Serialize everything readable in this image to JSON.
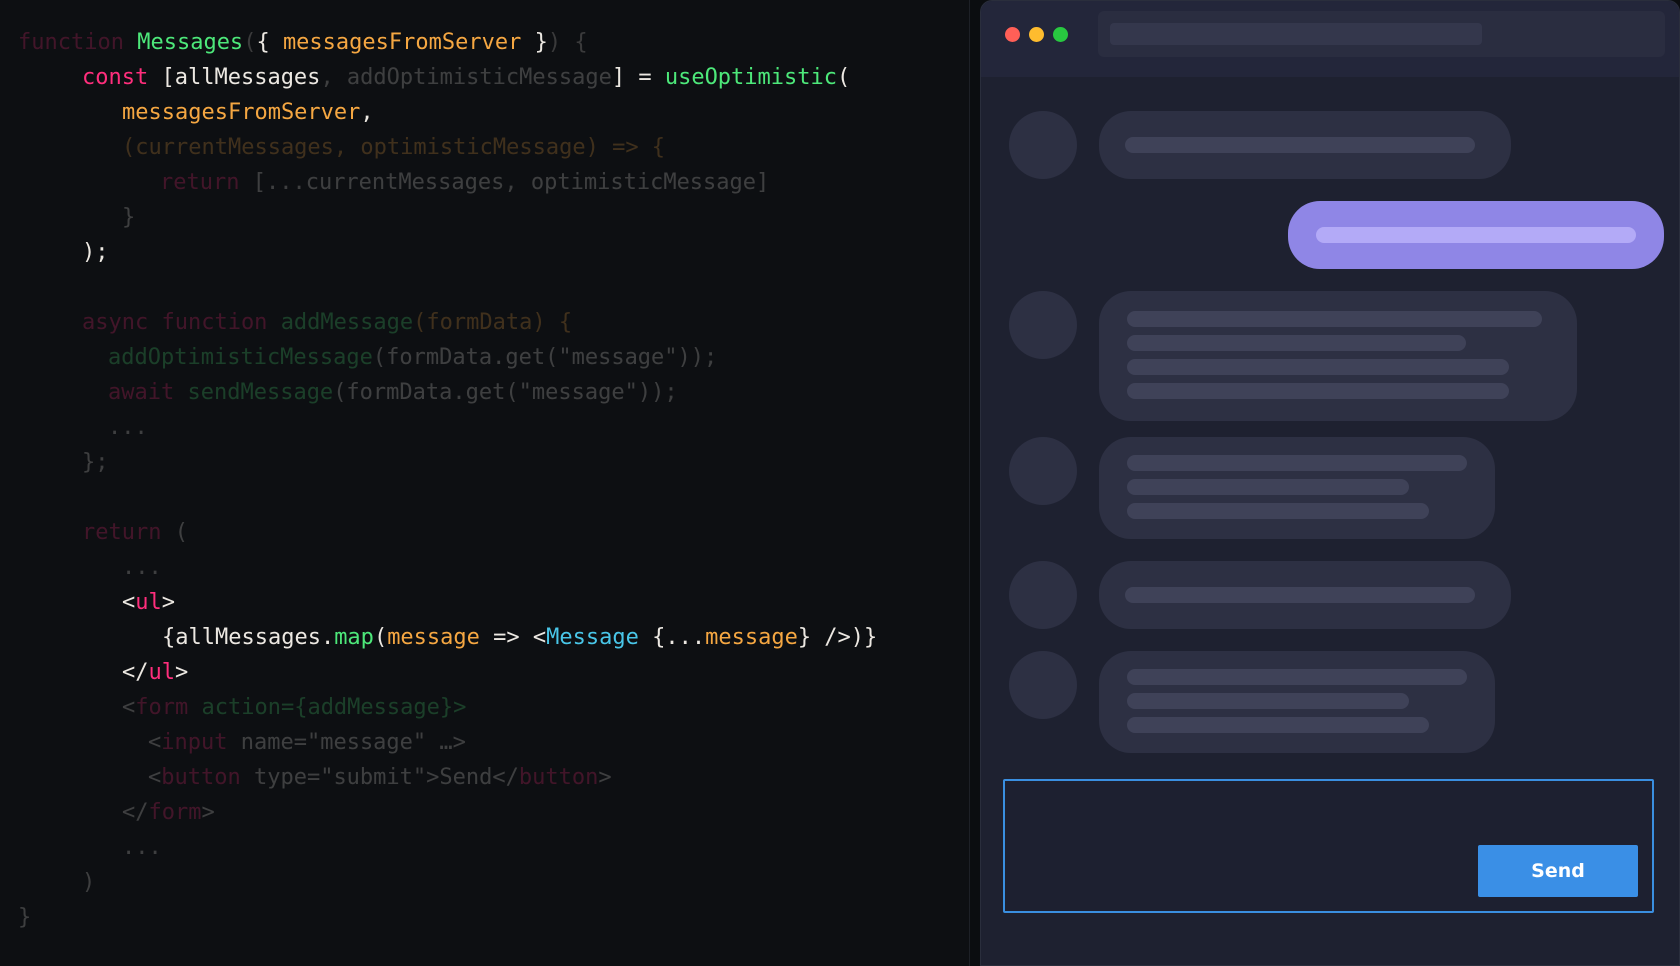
{
  "code_lines": [
    [
      {
        "t": "function ",
        "c": "kw",
        "d": true
      },
      {
        "t": "Messages",
        "c": "fn"
      },
      {
        "t": "(",
        "c": "punct",
        "d": true
      },
      {
        "t": "{ ",
        "c": "plain"
      },
      {
        "t": "messagesFromServer",
        "c": "param"
      },
      {
        "t": " }",
        "c": "plain"
      },
      {
        "t": ") {",
        "c": "punct",
        "d": true
      }
    ],
    [
      {
        "t": "const ",
        "c": "kw"
      },
      {
        "t": "[allMessages",
        "c": "plain"
      },
      {
        "t": ", addOptimisticMessage",
        "c": "plain",
        "d": true
      },
      {
        "t": "] = ",
        "c": "plain"
      },
      {
        "t": "useOptimistic",
        "c": "fn"
      },
      {
        "t": "(",
        "c": "plain"
      }
    ],
    [
      {
        "t": "messagesFromServer",
        "c": "param"
      },
      {
        "t": ",",
        "c": "plain"
      }
    ],
    [
      {
        "t": "(currentMessages, optimisticMessage) => {",
        "c": "param",
        "d": true
      }
    ],
    [
      {
        "t": "return ",
        "c": "kw",
        "d": true
      },
      {
        "t": "[...currentMessages, optimisticMessage]",
        "c": "plain",
        "d": true
      }
    ],
    [
      {
        "t": "}",
        "c": "plain",
        "d": true
      }
    ],
    [
      {
        "t": ");",
        "c": "plain"
      }
    ],
    [],
    [
      {
        "t": "async function ",
        "c": "kw",
        "d": true
      },
      {
        "t": "addMessage",
        "c": "fn",
        "d": true
      },
      {
        "t": "(formData) {",
        "c": "param",
        "d": true
      }
    ],
    [
      {
        "t": "addOptimisticMessage",
        "c": "fn",
        "d": true
      },
      {
        "t": "(formData.get(\"message\"));",
        "c": "plain",
        "d": true
      }
    ],
    [
      {
        "t": "await ",
        "c": "kw",
        "d": true
      },
      {
        "t": "sendMessage",
        "c": "fn",
        "d": true
      },
      {
        "t": "(formData.get(\"message\"));",
        "c": "plain",
        "d": true
      }
    ],
    [
      {
        "t": "...",
        "c": "plain",
        "d": true
      }
    ],
    [
      {
        "t": "};",
        "c": "plain",
        "d": true
      }
    ],
    [],
    [
      {
        "t": "return ",
        "c": "kw",
        "d": true
      },
      {
        "t": "(",
        "c": "plain",
        "d": true
      }
    ],
    [
      {
        "t": "...",
        "c": "plain",
        "d": true
      }
    ],
    [
      {
        "t": "<",
        "c": "plain"
      },
      {
        "t": "ul",
        "c": "tag"
      },
      {
        "t": ">",
        "c": "plain"
      }
    ],
    [
      {
        "t": "{allMessages.",
        "c": "plain"
      },
      {
        "t": "map",
        "c": "fn"
      },
      {
        "t": "(",
        "c": "plain"
      },
      {
        "t": "message",
        "c": "param"
      },
      {
        "t": " => <",
        "c": "plain"
      },
      {
        "t": "Message",
        "c": "comp"
      },
      {
        "t": " {...",
        "c": "plain"
      },
      {
        "t": "message",
        "c": "param"
      },
      {
        "t": "} />)}",
        "c": "plain"
      }
    ],
    [
      {
        "t": "</",
        "c": "plain"
      },
      {
        "t": "ul",
        "c": "tag"
      },
      {
        "t": ">",
        "c": "plain"
      }
    ],
    [
      {
        "t": "<",
        "c": "plain",
        "d": true
      },
      {
        "t": "form ",
        "c": "tag",
        "d": true
      },
      {
        "t": "action={addMessage}>",
        "c": "fn",
        "d": true
      }
    ],
    [
      {
        "t": "<",
        "c": "plain",
        "d": true
      },
      {
        "t": "input ",
        "c": "tag",
        "d": true
      },
      {
        "t": "name=\"message\" …>",
        "c": "plain",
        "d": true
      }
    ],
    [
      {
        "t": "<",
        "c": "plain",
        "d": true
      },
      {
        "t": "button ",
        "c": "tag",
        "d": true
      },
      {
        "t": "type=\"submit\">Send</",
        "c": "plain",
        "d": true
      },
      {
        "t": "button",
        "c": "tag",
        "d": true
      },
      {
        "t": ">",
        "c": "plain",
        "d": true
      }
    ],
    [
      {
        "t": "</",
        "c": "plain",
        "d": true
      },
      {
        "t": "form",
        "c": "tag",
        "d": true
      },
      {
        "t": ">",
        "c": "plain",
        "d": true
      }
    ],
    [
      {
        "t": "...",
        "c": "plain",
        "d": true
      }
    ],
    [
      {
        "t": ")",
        "c": "plain",
        "d": true
      }
    ],
    [
      {
        "t": "}",
        "c": "plain",
        "d": true
      }
    ]
  ],
  "chat": {
    "window_controls": [
      "close",
      "minimize",
      "zoom"
    ],
    "send_label": "Send"
  },
  "colors": {
    "keyword": "#ff2e7c",
    "function": "#4de87a",
    "parameter": "#f5a742",
    "component": "#49c6e8",
    "outgoing_bubble": "#8f86e6",
    "send_button": "#3a8fe6"
  }
}
